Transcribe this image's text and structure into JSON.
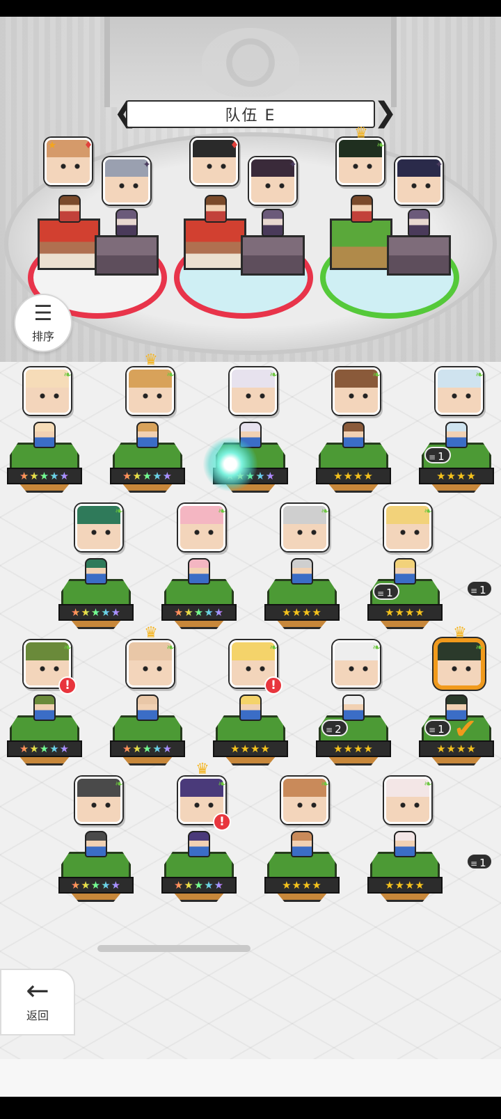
{
  "team": {
    "title": "队伍 E",
    "prev_arrow": "❮",
    "next_arrow": "❯"
  },
  "sort_button": {
    "label": "排序",
    "icon": "sort-icon"
  },
  "back_button": {
    "label": "返回",
    "icon": "arrow-left-icon"
  },
  "colors": {
    "red_ring": "#e8344a",
    "green_ring": "#55c93a",
    "selected_border": "#f19a1c",
    "alert": "#e8353d",
    "star": "#f5c21c"
  },
  "team_slots": [
    {
      "ring": "red",
      "front_element": "star-badge",
      "back_element": "dark"
    },
    {
      "ring": "red",
      "front_element": "fire",
      "back_element": "dark"
    },
    {
      "ring": "green",
      "front_element": "leaf",
      "back_element": "dark",
      "crown": true
    }
  ],
  "heroes": [
    {
      "id": "h1",
      "stars": "★★★★★",
      "rainbow": true,
      "element": "leaf",
      "skin": "#f6dcb8"
    },
    {
      "id": "h2",
      "stars": "★★★★★",
      "rainbow": true,
      "element": "leaf",
      "crown": true,
      "skin": "#d8a25a"
    },
    {
      "id": "h3",
      "stars": "★★★★★",
      "rainbow": true,
      "element": "leaf",
      "skin": "#e7e2ee"
    },
    {
      "id": "h4",
      "stars": "★★★★",
      "rainbow": false,
      "element": "leaf",
      "skin": "#8a5a3a"
    },
    {
      "id": "h5",
      "stars": "★★★★",
      "rainbow": false,
      "element": "leaf",
      "dup": "1",
      "skin": "#cfe3ef"
    },
    {
      "id": "h6",
      "stars": "★★★★★",
      "rainbow": true,
      "element": "leaf",
      "skin": "#2f7a5a"
    },
    {
      "id": "h7",
      "stars": "★★★★★",
      "rainbow": true,
      "element": "leaf",
      "skin": "#f4b6c2"
    },
    {
      "id": "h8",
      "stars": "★★★★",
      "rainbow": false,
      "element": "leaf",
      "skin": "#cfcfcf"
    },
    {
      "id": "h9",
      "stars": "★★★★",
      "rainbow": false,
      "element": "leaf",
      "dup": "1",
      "skin": "#f2d27a"
    },
    {
      "id": "h10",
      "stars": "★★★★★",
      "rainbow": true,
      "element": "leaf",
      "alert": "!",
      "skin": "#6a8a3a"
    },
    {
      "id": "h11",
      "stars": "★★★★★",
      "rainbow": true,
      "element": "leaf",
      "crown": true,
      "skin": "#e9c7a7"
    },
    {
      "id": "h12",
      "stars": "★★★★",
      "rainbow": false,
      "element": "leaf",
      "alert": "!",
      "skin": "#f4d36a"
    },
    {
      "id": "h13",
      "stars": "★★★★",
      "rainbow": false,
      "element": "leaf",
      "dup": "2",
      "skin": "#eeeeee"
    },
    {
      "id": "h14",
      "stars": "★★★★",
      "rainbow": false,
      "element": "leaf",
      "dup": "1",
      "crown": true,
      "selected": true,
      "skin": "#2b3a2b"
    },
    {
      "id": "h15",
      "stars": "★★★★★",
      "rainbow": true,
      "element": "leaf",
      "skin": "#4a4a4a"
    },
    {
      "id": "h16",
      "stars": "★★★★★",
      "rainbow": true,
      "element": "leaf",
      "crown": true,
      "alert": "!",
      "skin": "#4a3a7a"
    },
    {
      "id": "h17",
      "stars": "★★★★",
      "rainbow": false,
      "element": "leaf",
      "skin": "#c98a5a"
    },
    {
      "id": "h18",
      "stars": "★★★★",
      "rainbow": false,
      "element": "leaf",
      "skin": "#f3e6e6"
    }
  ],
  "edge_badges": [
    {
      "text": "1"
    },
    {
      "text": "1"
    }
  ]
}
